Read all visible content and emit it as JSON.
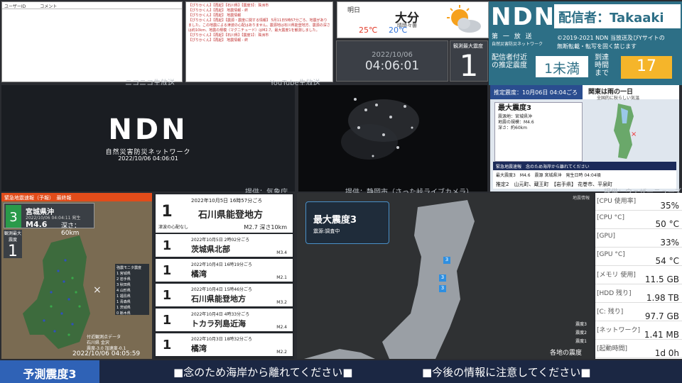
{
  "comments": {
    "col_user": "ユーザーID",
    "col_comment": "コメント"
  },
  "log_lines": [
    "【ぴりかくん】【再起】【石川県】【震度3】：珠洲市",
    "【ぴりかくん】【再起】 地震情報 - 終",
    "【ぴりかくん】【再起】 地震情報",
    "【ぴりかくん】【再起】【震源・震度に関する情報】 5月11日5時57分ごろ、地震がありました。この地震による津波の心配はありません。震源地は石川県能登地方、震源の深さは約10km、地震の規模（マグニチュード）はM2.7。最大震度1を観測しました。",
    "【ぴりかくん】【再起】【石川県】【震度1】：珠洲市",
    "【ぴりかくん】【再起】 地震情報 - 終"
  ],
  "captions": {
    "niconico": "ニコニコ生放送",
    "youtube": "YouTube生放送",
    "jma": "提供：気象庁",
    "shizuoka": "提供：静岡市（さった峠ライブカメラ）",
    "weathernews": "提供：ウェザーニューズ"
  },
  "weather": {
    "day": "明日",
    "city": "大分",
    "city_sub": "晴時々曇",
    "high": "25℃",
    "low": "20℃",
    "icon": "sun-cloud-icon"
  },
  "clock": {
    "date": "2022/10/06",
    "time": "04:06:01"
  },
  "max_int": {
    "label": "観測最大震度",
    "value": "1"
  },
  "ndn": {
    "logo": "NDN",
    "caster": "配信者：Takaaki",
    "sub1": "第 一 放 送",
    "sub2": "自然災害防災ネットワーク",
    "copy1": "©2019-2021 NDN 当放送及びYサイトの",
    "copy2": "無断転載・転写を固く禁じます",
    "est_label": "配信者付近の推定震度",
    "est_value": "1未満",
    "arrival_label": "到達時間まで",
    "arrival_value": "17"
  },
  "video": {
    "logo": "NDN",
    "subtitle": "自然災害防災ネットワーク",
    "timestamp": "2022/10/06 04:06:01"
  },
  "bulletin": {
    "top": "推定震度：10月06日 04:04ごろ",
    "head": "関東は雨の一日",
    "head2": "全国的に秋らしい気温",
    "title": "最大震度3",
    "l1": "震源地：宮城県沖",
    "l2": "地震の規模：M4.6",
    "l3": "深さ：約60km",
    "bar1": "緊急地震速報　念のため海岸から離れてください",
    "bar2": "最大震度3　M4.6　震源 宮城県沖　発生日時 04:04頃",
    "bar3": "推定2　山元町、蔵王町　【岩手県】 花巻市、平泉町"
  },
  "eew": {
    "header": "緊急地震速報（予報）　最終報",
    "intensity": "3",
    "area": "宮城県沖",
    "origin": "2022/10/06 04:04:11 発生",
    "mag": "M4.6",
    "depth": "深さ：60km",
    "obs_label": "観測最大震度",
    "obs_value": "1",
    "legend": [
      "強震モニタ震度",
      "1 宮城県",
      "2 岩手県",
      "3 秋田県",
      "4 山形県",
      "1 福島県",
      "1 青森県",
      "1 茨城県",
      "0 栃木県"
    ],
    "sub": "付近観測点データ\n石川県 金沢\n震度-3.0 加速度-0.1",
    "timestamp": "2022/10/06 04:05:59"
  },
  "events": [
    {
      "n": "1",
      "date": "2022年10月5日 16時57分ごろ",
      "place": "石川県能登地方",
      "mag": "M2.7 深さ10km",
      "note": "津波の心配なし"
    },
    {
      "n": "1",
      "date": "2022年10月5日 2時02分ごろ",
      "place": "茨城県北部",
      "mag": "M3.4"
    },
    {
      "n": "1",
      "date": "2022年10月4日 16時19分ごろ",
      "place": "橘湾",
      "mag": "M2.1"
    },
    {
      "n": "1",
      "date": "2022年10月4日 15時46分ごろ",
      "place": "石川県能登地方",
      "mag": "M3.2"
    },
    {
      "n": "1",
      "date": "2022年10月4日 4時33分ごろ",
      "place": "トカラ列島近海",
      "mag": "M2.4"
    },
    {
      "n": "1",
      "date": "2022年10月3日 18時32分ごろ",
      "place": "橘湾",
      "mag": "M2.2"
    }
  ],
  "mapinfo": {
    "title": "最大震度3",
    "sub": "震源:調査中",
    "corner": "地震情報",
    "legend1": "震度3",
    "legend2": "震度2",
    "legend3": "震度1",
    "footer": "各地の震度",
    "markers": [
      "3",
      "3",
      "3"
    ]
  },
  "stats": [
    {
      "k": "[CPU 使用率]",
      "v": "35%"
    },
    {
      "k": "[CPU °C]",
      "v": "50 °C"
    },
    {
      "k": "[GPU]",
      "v": "33%"
    },
    {
      "k": "[GPU °C]",
      "v": "54 °C"
    },
    {
      "k": "[メモリ 使用]",
      "v": "11.5 GB"
    },
    {
      "k": "[HDD 残り]",
      "v": "1.98 TB"
    },
    {
      "k": "[C: 残り]",
      "v": "97.7 GB"
    },
    {
      "k": "[ネットワーク]",
      "v": "1.41 MB"
    },
    {
      "k": "[起動時間]",
      "v": "1d 0h"
    }
  ],
  "ticker": {
    "label": "予測震度3",
    "m1": "■念のため海岸から離れてください■",
    "m2": "■今後の情報に注意してください■"
  }
}
